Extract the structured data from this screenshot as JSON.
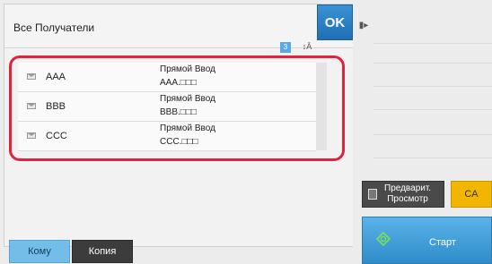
{
  "dialog": {
    "title": "Все Получатели",
    "ok_label": "OK",
    "count_badge": "3",
    "sort_icon": "sort-icon"
  },
  "recipients": [
    {
      "name": "AAA",
      "method": "Прямой Ввод",
      "address": "AAA.□□□"
    },
    {
      "name": "BBB",
      "method": "Прямой Ввод",
      "address": "BBB.□□□"
    },
    {
      "name": "CCC",
      "method": "Прямой Ввод",
      "address": "CCC.□□□"
    }
  ],
  "tabs": {
    "to_label": "Кому",
    "cc_label": "Копия"
  },
  "actions": {
    "preview_label_1": "Предварит.",
    "preview_label_2": "Просмотр",
    "ca_label": "CA",
    "start_label": "Старт"
  },
  "colors": {
    "accent_blue": "#2f8cc9",
    "highlight_red": "#e0233b",
    "ca_yellow": "#f2b600"
  }
}
